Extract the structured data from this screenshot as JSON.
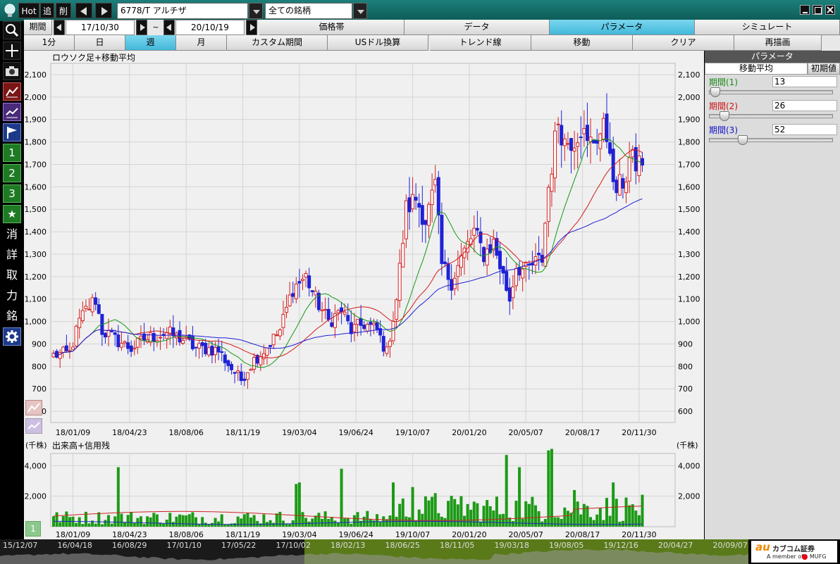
{
  "titlebar": {
    "hot": "Hot",
    "add": "追",
    "del": "削",
    "symbol": "6778/T アルチザ",
    "category": "全ての銘柄"
  },
  "toolbar_left": {
    "text_buttons": [
      "消",
      "詳",
      "取",
      "力",
      "銘"
    ],
    "num_buttons": [
      "1",
      "2",
      "3"
    ]
  },
  "period_row": {
    "label": "期間",
    "start": "17/10/30",
    "tilde": "~",
    "end": "20/10/19",
    "tabs": [
      {
        "label": "価格帯",
        "selected": false
      },
      {
        "label": "データ",
        "selected": false
      },
      {
        "label": "パラメータ",
        "selected": true
      },
      {
        "label": "シミュレート",
        "selected": false
      }
    ]
  },
  "interval_row": {
    "buttons": [
      {
        "label": "1分",
        "selected": false
      },
      {
        "label": "日",
        "selected": false
      },
      {
        "label": "週",
        "selected": true
      },
      {
        "label": "月",
        "selected": false
      },
      {
        "label": "カスタム期間",
        "selected": false
      },
      {
        "label": "USドル換算",
        "selected": false
      },
      {
        "label": "トレンド線",
        "selected": false
      },
      {
        "label": "移動",
        "selected": false
      },
      {
        "label": "クリア",
        "selected": false
      },
      {
        "label": "再描画",
        "selected": false
      }
    ]
  },
  "param_panel": {
    "title": "パラメータ",
    "tab": "移動平均",
    "reset": "初期値",
    "periods": [
      {
        "label": "期間(1)",
        "value": "13",
        "color": "#1a8a1a",
        "pos": 0.03
      },
      {
        "label": "期間(2)",
        "value": "26",
        "color": "#cc1111",
        "pos": 0.1
      },
      {
        "label": "期間(3)",
        "value": "52",
        "color": "#1111cc",
        "pos": 0.25
      }
    ]
  },
  "colors": {
    "up": "#d22020",
    "down": "#1e22d6",
    "ma13": "#139913",
    "ma26": "#d41a1a",
    "ma52": "#1f1fd6",
    "volume": "#1c9a16"
  },
  "chart_data": [
    {
      "type": "candlestick",
      "title": "ロウソク足+移動平均",
      "ylim": [
        550,
        2150
      ],
      "yticks": [
        600,
        700,
        800,
        900,
        1000,
        1100,
        1200,
        1300,
        1400,
        1500,
        1600,
        1700,
        1800,
        1900,
        2000,
        2100
      ],
      "ytick_labels": [
        "600",
        "700",
        "800",
        "900",
        "1,000",
        "1,100",
        "1,200",
        "1,300",
        "1,400",
        "1,500",
        "1,600",
        "1,700",
        "1,800",
        "1,900",
        "2,000",
        "2,100"
      ],
      "xticks": [
        "18/01/09",
        "18/04/23",
        "18/08/06",
        "18/11/19",
        "19/03/04",
        "19/06/24",
        "19/10/07",
        "20/01/20",
        "20/05/07",
        "20/08/17",
        "20/11/30"
      ],
      "waypoints": [
        [
          0,
          850
        ],
        [
          5,
          860
        ],
        [
          8,
          1000
        ],
        [
          10,
          1050
        ],
        [
          13,
          1100
        ],
        [
          15,
          960
        ],
        [
          19,
          920
        ],
        [
          24,
          880
        ],
        [
          28,
          920
        ],
        [
          35,
          950
        ],
        [
          40,
          920
        ],
        [
          44,
          880
        ],
        [
          47,
          880
        ],
        [
          51,
          870
        ],
        [
          55,
          790
        ],
        [
          58,
          740
        ],
        [
          62,
          830
        ],
        [
          65,
          870
        ],
        [
          70,
          960
        ],
        [
          74,
          1150
        ],
        [
          78,
          1200
        ],
        [
          81,
          1100
        ],
        [
          85,
          1000
        ],
        [
          89,
          1050
        ],
        [
          92,
          960
        ],
        [
          96,
          990
        ],
        [
          100,
          960
        ],
        [
          103,
          860
        ],
        [
          106,
          1100
        ],
        [
          109,
          1500
        ],
        [
          112,
          1550
        ],
        [
          115,
          1450
        ],
        [
          118,
          1600
        ],
        [
          120,
          1250
        ],
        [
          123,
          1180
        ],
        [
          126,
          1280
        ],
        [
          130,
          1400
        ],
        [
          133,
          1300
        ],
        [
          136,
          1350
        ],
        [
          138,
          1250
        ],
        [
          141,
          1100
        ],
        [
          143,
          1250
        ],
        [
          146,
          1220
        ],
        [
          148,
          1250
        ],
        [
          151,
          1280
        ],
        [
          153,
          1600
        ],
        [
          156,
          1900
        ],
        [
          158,
          1800
        ],
        [
          161,
          1820
        ],
        [
          163,
          1870
        ],
        [
          165,
          1780
        ],
        [
          168,
          1830
        ],
        [
          170,
          1850
        ],
        [
          172,
          1800
        ],
        [
          173,
          1580
        ],
        [
          175,
          1600
        ],
        [
          177,
          1650
        ],
        [
          178,
          1720
        ],
        [
          180,
          1700
        ],
        [
          182,
          1720
        ]
      ],
      "ma_periods": [
        13,
        26,
        52
      ]
    },
    {
      "type": "bar",
      "title": "出来高+信用残",
      "unit": "(千株)",
      "ylim": [
        0,
        4800
      ],
      "yticks": [
        2000,
        4000
      ],
      "ytick_labels": [
        "2,000",
        "4,000"
      ],
      "spikes": [
        [
          20,
          3900
        ],
        [
          75,
          2800
        ],
        [
          76,
          2900
        ],
        [
          89,
          3800
        ],
        [
          105,
          2900
        ],
        [
          111,
          2600
        ],
        [
          118,
          2200
        ],
        [
          126,
          2000
        ],
        [
          140,
          4700
        ],
        [
          144,
          3900
        ],
        [
          153,
          5000
        ],
        [
          154,
          5100
        ],
        [
          161,
          2400
        ],
        [
          173,
          2900
        ],
        [
          178,
          1400
        ]
      ]
    },
    {
      "type": "area",
      "xticks": [
        "15/12/07",
        "16/04/18",
        "16/08/29",
        "17/01/10",
        "17/05/22",
        "17/10/02",
        "18/02/13",
        "18/06/25",
        "18/11/05",
        "19/03/18",
        "19/08/05",
        "19/12/16",
        "20/04/27",
        "20/09/07"
      ]
    }
  ],
  "logo": {
    "brand": "au",
    "name": "カブコム証券",
    "tagline": "A member of",
    "group": "MUFG"
  },
  "lower_buttons": {
    "volume_toggle": "1"
  }
}
